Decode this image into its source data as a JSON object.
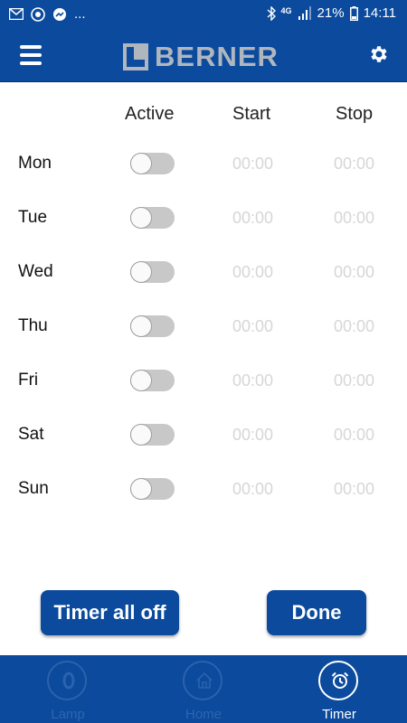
{
  "status_bar": {
    "left_icons": [
      "mail-icon",
      "chrome-icon",
      "messenger-icon"
    ],
    "more": "...",
    "right_icons": [
      "bluetooth-icon",
      "network-4g-icon",
      "signal-icon",
      "battery-icon"
    ],
    "network": "4G",
    "battery": "21%",
    "time": "14:11"
  },
  "header": {
    "brand": "BERNER",
    "left_icon": "hamburger-menu-icon",
    "right_icon": "gear-icon"
  },
  "table": {
    "columns": [
      "Active",
      "Start",
      "Stop"
    ],
    "rows": [
      {
        "day": "Mon",
        "active": false,
        "start": "00:00",
        "stop": "00:00"
      },
      {
        "day": "Tue",
        "active": false,
        "start": "00:00",
        "stop": "00:00"
      },
      {
        "day": "Wed",
        "active": false,
        "start": "00:00",
        "stop": "00:00"
      },
      {
        "day": "Thu",
        "active": false,
        "start": "00:00",
        "stop": "00:00"
      },
      {
        "day": "Fri",
        "active": false,
        "start": "00:00",
        "stop": "00:00"
      },
      {
        "day": "Sat",
        "active": false,
        "start": "00:00",
        "stop": "00:00"
      },
      {
        "day": "Sun",
        "active": false,
        "start": "00:00",
        "stop": "00:00"
      }
    ]
  },
  "buttons": {
    "timer_all_off": "Timer all off",
    "done": "Done"
  },
  "bottom_nav": [
    {
      "label": "Lamp",
      "icon": "lamp-icon",
      "active": false
    },
    {
      "label": "Home",
      "icon": "home-icon",
      "active": false
    },
    {
      "label": "Timer",
      "icon": "alarm-clock-icon",
      "active": true
    }
  ],
  "colors": {
    "primary": "#0b4a9c",
    "brand_gray": "#b0b6be",
    "toggle_off": "#c8c8c8",
    "time_disabled": "#d6d6d6",
    "nav_inactive": "#2e66ad"
  }
}
